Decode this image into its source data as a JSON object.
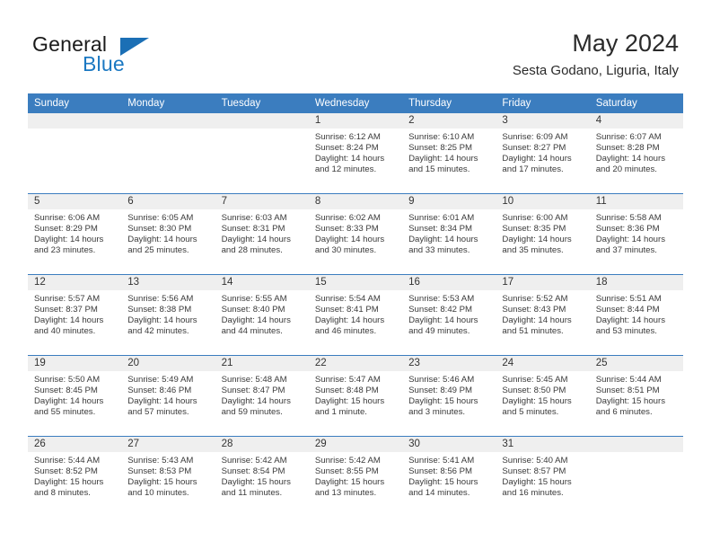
{
  "brand": {
    "line1": "General",
    "line2": "Blue",
    "triangle_icon": "brand-triangle-icon",
    "accent_color": "#1b6fb5"
  },
  "header": {
    "title": "May 2024",
    "location": "Sesta Godano, Liguria, Italy"
  },
  "theme": {
    "header_blue": "#3b7dbf",
    "daynum_band": "#efefef",
    "text": "#3a3a3a"
  },
  "weekday_headers": [
    "Sunday",
    "Monday",
    "Tuesday",
    "Wednesday",
    "Thursday",
    "Friday",
    "Saturday"
  ],
  "labels": {
    "sunrise": "Sunrise:",
    "sunset": "Sunset:",
    "daylight": "Daylight:"
  },
  "weeks": [
    [
      {
        "day": "",
        "empty": true
      },
      {
        "day": "",
        "empty": true
      },
      {
        "day": "",
        "empty": true
      },
      {
        "day": "1",
        "sunrise": "Sunrise: 6:12 AM",
        "sunset": "Sunset: 8:24 PM",
        "daylight1": "Daylight: 14 hours",
        "daylight2": "and 12 minutes."
      },
      {
        "day": "2",
        "sunrise": "Sunrise: 6:10 AM",
        "sunset": "Sunset: 8:25 PM",
        "daylight1": "Daylight: 14 hours",
        "daylight2": "and 15 minutes."
      },
      {
        "day": "3",
        "sunrise": "Sunrise: 6:09 AM",
        "sunset": "Sunset: 8:27 PM",
        "daylight1": "Daylight: 14 hours",
        "daylight2": "and 17 minutes."
      },
      {
        "day": "4",
        "sunrise": "Sunrise: 6:07 AM",
        "sunset": "Sunset: 8:28 PM",
        "daylight1": "Daylight: 14 hours",
        "daylight2": "and 20 minutes."
      }
    ],
    [
      {
        "day": "5",
        "sunrise": "Sunrise: 6:06 AM",
        "sunset": "Sunset: 8:29 PM",
        "daylight1": "Daylight: 14 hours",
        "daylight2": "and 23 minutes."
      },
      {
        "day": "6",
        "sunrise": "Sunrise: 6:05 AM",
        "sunset": "Sunset: 8:30 PM",
        "daylight1": "Daylight: 14 hours",
        "daylight2": "and 25 minutes."
      },
      {
        "day": "7",
        "sunrise": "Sunrise: 6:03 AM",
        "sunset": "Sunset: 8:31 PM",
        "daylight1": "Daylight: 14 hours",
        "daylight2": "and 28 minutes."
      },
      {
        "day": "8",
        "sunrise": "Sunrise: 6:02 AM",
        "sunset": "Sunset: 8:33 PM",
        "daylight1": "Daylight: 14 hours",
        "daylight2": "and 30 minutes."
      },
      {
        "day": "9",
        "sunrise": "Sunrise: 6:01 AM",
        "sunset": "Sunset: 8:34 PM",
        "daylight1": "Daylight: 14 hours",
        "daylight2": "and 33 minutes."
      },
      {
        "day": "10",
        "sunrise": "Sunrise: 6:00 AM",
        "sunset": "Sunset: 8:35 PM",
        "daylight1": "Daylight: 14 hours",
        "daylight2": "and 35 minutes."
      },
      {
        "day": "11",
        "sunrise": "Sunrise: 5:58 AM",
        "sunset": "Sunset: 8:36 PM",
        "daylight1": "Daylight: 14 hours",
        "daylight2": "and 37 minutes."
      }
    ],
    [
      {
        "day": "12",
        "sunrise": "Sunrise: 5:57 AM",
        "sunset": "Sunset: 8:37 PM",
        "daylight1": "Daylight: 14 hours",
        "daylight2": "and 40 minutes."
      },
      {
        "day": "13",
        "sunrise": "Sunrise: 5:56 AM",
        "sunset": "Sunset: 8:38 PM",
        "daylight1": "Daylight: 14 hours",
        "daylight2": "and 42 minutes."
      },
      {
        "day": "14",
        "sunrise": "Sunrise: 5:55 AM",
        "sunset": "Sunset: 8:40 PM",
        "daylight1": "Daylight: 14 hours",
        "daylight2": "and 44 minutes."
      },
      {
        "day": "15",
        "sunrise": "Sunrise: 5:54 AM",
        "sunset": "Sunset: 8:41 PM",
        "daylight1": "Daylight: 14 hours",
        "daylight2": "and 46 minutes."
      },
      {
        "day": "16",
        "sunrise": "Sunrise: 5:53 AM",
        "sunset": "Sunset: 8:42 PM",
        "daylight1": "Daylight: 14 hours",
        "daylight2": "and 49 minutes."
      },
      {
        "day": "17",
        "sunrise": "Sunrise: 5:52 AM",
        "sunset": "Sunset: 8:43 PM",
        "daylight1": "Daylight: 14 hours",
        "daylight2": "and 51 minutes."
      },
      {
        "day": "18",
        "sunrise": "Sunrise: 5:51 AM",
        "sunset": "Sunset: 8:44 PM",
        "daylight1": "Daylight: 14 hours",
        "daylight2": "and 53 minutes."
      }
    ],
    [
      {
        "day": "19",
        "sunrise": "Sunrise: 5:50 AM",
        "sunset": "Sunset: 8:45 PM",
        "daylight1": "Daylight: 14 hours",
        "daylight2": "and 55 minutes."
      },
      {
        "day": "20",
        "sunrise": "Sunrise: 5:49 AM",
        "sunset": "Sunset: 8:46 PM",
        "daylight1": "Daylight: 14 hours",
        "daylight2": "and 57 minutes."
      },
      {
        "day": "21",
        "sunrise": "Sunrise: 5:48 AM",
        "sunset": "Sunset: 8:47 PM",
        "daylight1": "Daylight: 14 hours",
        "daylight2": "and 59 minutes."
      },
      {
        "day": "22",
        "sunrise": "Sunrise: 5:47 AM",
        "sunset": "Sunset: 8:48 PM",
        "daylight1": "Daylight: 15 hours",
        "daylight2": "and 1 minute."
      },
      {
        "day": "23",
        "sunrise": "Sunrise: 5:46 AM",
        "sunset": "Sunset: 8:49 PM",
        "daylight1": "Daylight: 15 hours",
        "daylight2": "and 3 minutes."
      },
      {
        "day": "24",
        "sunrise": "Sunrise: 5:45 AM",
        "sunset": "Sunset: 8:50 PM",
        "daylight1": "Daylight: 15 hours",
        "daylight2": "and 5 minutes."
      },
      {
        "day": "25",
        "sunrise": "Sunrise: 5:44 AM",
        "sunset": "Sunset: 8:51 PM",
        "daylight1": "Daylight: 15 hours",
        "daylight2": "and 6 minutes."
      }
    ],
    [
      {
        "day": "26",
        "sunrise": "Sunrise: 5:44 AM",
        "sunset": "Sunset: 8:52 PM",
        "daylight1": "Daylight: 15 hours",
        "daylight2": "and 8 minutes."
      },
      {
        "day": "27",
        "sunrise": "Sunrise: 5:43 AM",
        "sunset": "Sunset: 8:53 PM",
        "daylight1": "Daylight: 15 hours",
        "daylight2": "and 10 minutes."
      },
      {
        "day": "28",
        "sunrise": "Sunrise: 5:42 AM",
        "sunset": "Sunset: 8:54 PM",
        "daylight1": "Daylight: 15 hours",
        "daylight2": "and 11 minutes."
      },
      {
        "day": "29",
        "sunrise": "Sunrise: 5:42 AM",
        "sunset": "Sunset: 8:55 PM",
        "daylight1": "Daylight: 15 hours",
        "daylight2": "and 13 minutes."
      },
      {
        "day": "30",
        "sunrise": "Sunrise: 5:41 AM",
        "sunset": "Sunset: 8:56 PM",
        "daylight1": "Daylight: 15 hours",
        "daylight2": "and 14 minutes."
      },
      {
        "day": "31",
        "sunrise": "Sunrise: 5:40 AM",
        "sunset": "Sunset: 8:57 PM",
        "daylight1": "Daylight: 15 hours",
        "daylight2": "and 16 minutes."
      },
      {
        "day": "",
        "empty": true
      }
    ]
  ]
}
